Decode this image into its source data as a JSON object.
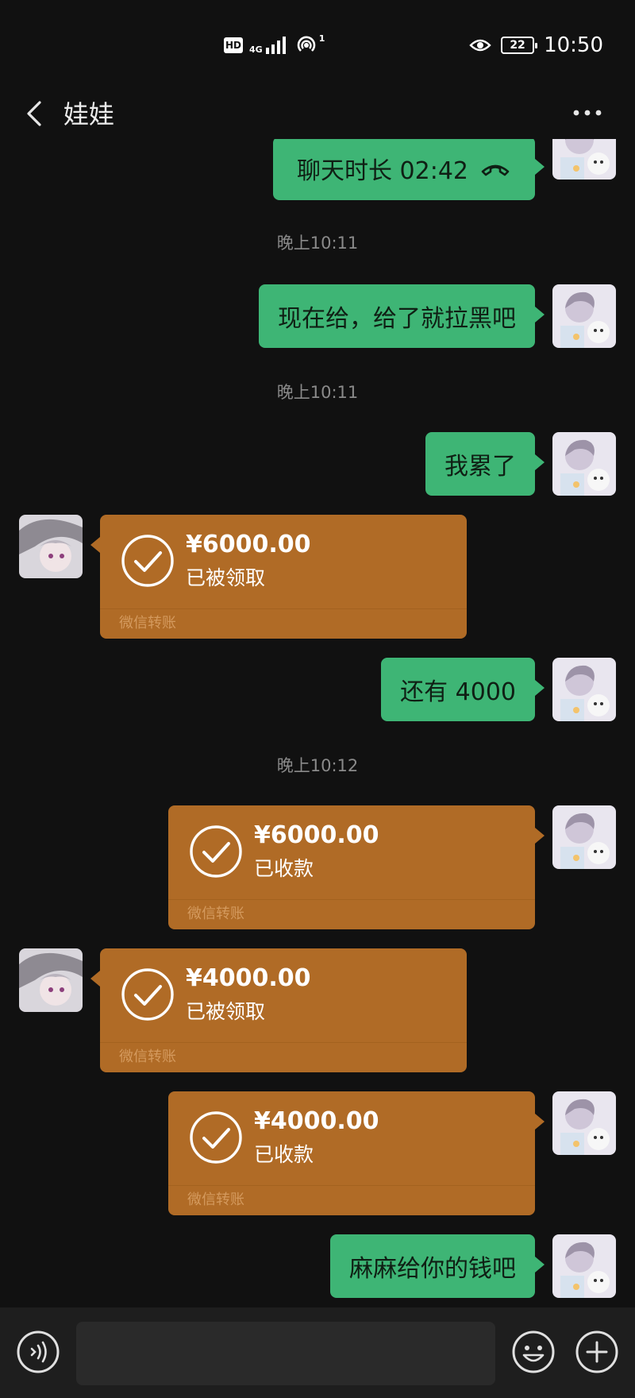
{
  "status_bar": {
    "hd": "HD",
    "network": "4G",
    "hotspot_count": "1",
    "battery": "22",
    "time": "10:50"
  },
  "header": {
    "title": "娃娃"
  },
  "messages": {
    "call": {
      "text": "聊天时长 02:42"
    },
    "ts1": "晚上10:11",
    "m1": "现在给，给了就拉黑吧",
    "ts2": "晚上10:11",
    "m2": "我累了",
    "tr1": {
      "amount": "¥6000.00",
      "status": "已被领取",
      "footer": "微信转账"
    },
    "m3": "还有 4000",
    "ts3": "晚上10:12",
    "tr2": {
      "amount": "¥6000.00",
      "status": "已收款",
      "footer": "微信转账"
    },
    "tr3": {
      "amount": "¥4000.00",
      "status": "已被领取",
      "footer": "微信转账"
    },
    "tr4": {
      "amount": "¥4000.00",
      "status": "已收款",
      "footer": "微信转账"
    },
    "m4": "麻麻给你的钱吧"
  },
  "colors": {
    "background": "#111111",
    "my_bubble": "#3eb575",
    "transfer_card": "#b06b26"
  }
}
